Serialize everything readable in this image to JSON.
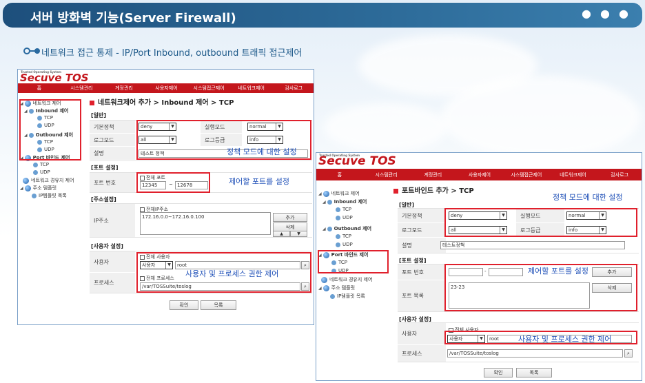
{
  "header": {
    "title": "서버 방화벽 기능(Server Firewall)",
    "dots": "● ● ●",
    "subtitle": "네트워크 접근 통제 - IP/Port Inbound, outbound 트래픽 접근제어"
  },
  "app": {
    "logo": "Secuve TOS",
    "logo_tag": "Trusted Operating System",
    "menu": [
      "홈",
      "시스템관리",
      "계정관리",
      "사용자제어",
      "시스템접근제어",
      "네트워크제어",
      "감사로그"
    ]
  },
  "panel1": {
    "tree": {
      "network_control": "네트워크 제어",
      "inbound": "Inbound 제어",
      "tcp": "TCP",
      "udp": "UDP",
      "outbound": "Outbound 제어",
      "tcp2": "TCP",
      "udp2": "UDP",
      "port_bind": "Port 바인드 제어",
      "tcp3": "TCP",
      "udp3": "UDP",
      "route": "네트워크 경유지 제어",
      "addr_template": "주소 템플릿",
      "ip_template_list": "IP템플릿 목록"
    },
    "form_title": "네트워크제어 추가 > Inbound 제어 > TCP",
    "sec_general": "[일반]",
    "basic_policy_label": "기본정책",
    "basic_policy_value": "deny",
    "exec_mode_label": "실행모드",
    "exec_mode_value": "normal",
    "log_mode_label": "로그모드",
    "log_mode_value": "all",
    "log_level_label": "로그등급",
    "log_level_value": "info",
    "desc_label": "설명",
    "desc_value": "테스트 정책",
    "sec_port": "[포트 설정]",
    "port_label": "포트 번호",
    "all_ports": "전체 포트",
    "port_from": "12345",
    "port_sep": "~",
    "port_to": "12678",
    "sec_addr": "[주소설정]",
    "ip_label": "IP주소",
    "all_ip": "전체IP주소",
    "ip_value": "172.16.0.0~172.16.0.100",
    "add_btn": "추가",
    "del_btn": "삭제",
    "up_btn": "▲",
    "down_btn": "▼",
    "sec_user": "[사용자 설정]",
    "user_label": "사용자",
    "all_users": "전체 사용자",
    "user_select": "사용자",
    "user_value": "root",
    "process_label": "프로세스",
    "all_process": "전체 프로세스",
    "process_value": "/var/TOSSuite/toslog",
    "ok_btn": "확인",
    "list_btn": "목록",
    "annot_policy": "정책 모드에 대한 설정",
    "annot_port": "제어할 포트를 설정",
    "annot_user": "사용자 및 프로세스 권한 제어"
  },
  "panel2": {
    "tree": {
      "network_control": "네트워크 제어",
      "inbound": "Inbound 제어",
      "tcp": "TCP",
      "udp": "UDP",
      "outbound": "Outbound 제어",
      "tcp2": "TCP",
      "udp2": "UDP",
      "port_bind": "Port 바인드 제어",
      "tcp3": "TCP",
      "udp3": "UDP",
      "route": "네트워크 경유지 제어",
      "addr_template": "주소 템플릿",
      "ip_template_list": "IP템플릿 목록"
    },
    "form_title": "포트바인드 추가 > TCP",
    "sec_general": "[일반]",
    "basic_policy_label": "기본정책",
    "basic_policy_value": "deny",
    "exec_mode_label": "실행모드",
    "exec_mode_value": "normal",
    "log_mode_label": "로그모드",
    "log_mode_value": "all",
    "log_level_label": "로그등급",
    "log_level_value": "info",
    "desc_label": "설명",
    "desc_value": "테스트정책",
    "sec_port": "[포트 설정]",
    "port_label": "포트 번호",
    "port_sep": "-",
    "add_btn": "추가",
    "port_list_label": "포트 목록",
    "port_list_value": "23-23",
    "del_btn": "삭제",
    "sec_user": "[사용자 설정]",
    "user_label": "사용자",
    "all_users": "전체 사용자",
    "user_select": "사용자",
    "user_value": "root",
    "process_label": "프로세스",
    "process_value": "/var/TOSSuite/toslog",
    "ok_btn": "확인",
    "list_btn": "목록",
    "annot_policy": "정책 모드에 대한 설정",
    "annot_port": "제어할 포트를 설정",
    "annot_user": "사용자 및 프로세스 권한 제어"
  },
  "colors": {
    "brand_red": "#c4161c",
    "title_blue": "#1d4f7c",
    "annot_blue": "#1f50b8",
    "highlight_red": "#e0202c"
  }
}
